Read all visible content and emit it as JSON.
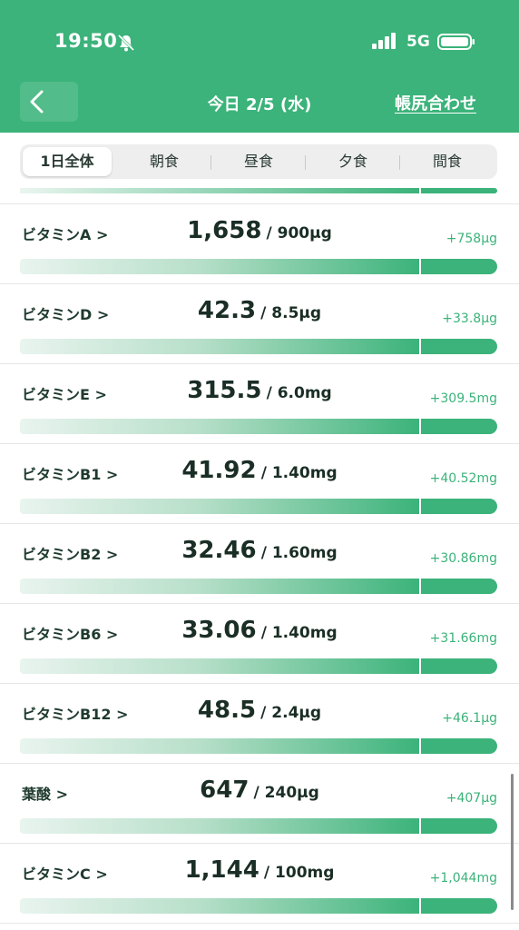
{
  "status": {
    "time": "19:50",
    "network": "5G"
  },
  "nav": {
    "title": "今日 2/5 (水)",
    "action": "帳尻合わせ"
  },
  "tabs": [
    {
      "label": "1日全体",
      "active": true
    },
    {
      "label": "朝食",
      "active": false
    },
    {
      "label": "昼食",
      "active": false
    },
    {
      "label": "夕食",
      "active": false
    },
    {
      "label": "間食",
      "active": false
    }
  ],
  "nutrients": [
    {
      "name": "ビタミンA >",
      "value": "1,658",
      "target": "/ 900µg",
      "diff": "+758µg"
    },
    {
      "name": "ビタミンD >",
      "value": "42.3",
      "target": "/ 8.5µg",
      "diff": "+33.8µg"
    },
    {
      "name": "ビタミンE >",
      "value": "315.5",
      "target": "/ 6.0mg",
      "diff": "+309.5mg"
    },
    {
      "name": "ビタミンB1 >",
      "value": "41.92",
      "target": "/ 1.40mg",
      "diff": "+40.52mg"
    },
    {
      "name": "ビタミンB2 >",
      "value": "32.46",
      "target": "/ 1.60mg",
      "diff": "+30.86mg"
    },
    {
      "name": "ビタミンB6 >",
      "value": "33.06",
      "target": "/ 1.40mg",
      "diff": "+31.66mg"
    },
    {
      "name": "ビタミンB12 >",
      "value": "48.5",
      "target": "/ 2.4µg",
      "diff": "+46.1µg"
    },
    {
      "name": "葉酸 >",
      "value": "647",
      "target": "/ 240µg",
      "diff": "+407µg"
    },
    {
      "name": "ビタミンC >",
      "value": "1,144",
      "target": "/ 100mg",
      "diff": "+1,044mg"
    }
  ],
  "colors": {
    "accent": "#3bb37a",
    "text": "#1f3a2e"
  },
  "icons": {
    "back": "chevron-left-icon",
    "bell": "bell-slash-icon"
  }
}
